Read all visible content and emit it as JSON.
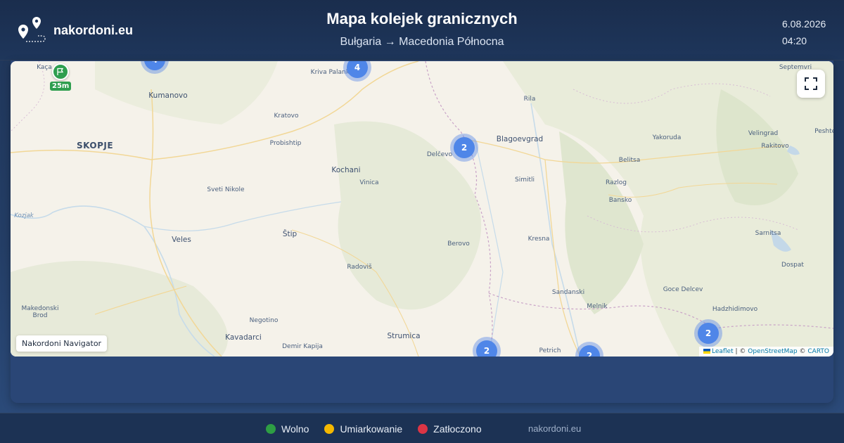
{
  "header": {
    "brand": "nakordoni.eu",
    "title": "Mapa kolejek granicznych",
    "subtitle": "Bułgaria → Macedonia Północna",
    "date": "6.08.2026",
    "time": "04:20"
  },
  "map": {
    "places": [
      {
        "name": "Kaça",
        "cls": "small"
      },
      {
        "name": "Kumanovo",
        "cls": "mid"
      },
      {
        "name": "Kriva Palanka",
        "cls": "small"
      },
      {
        "name": "Septemvri",
        "cls": "small"
      },
      {
        "name": "Rila",
        "cls": "small"
      },
      {
        "name": "Kratovo",
        "cls": "small"
      },
      {
        "name": "SKOPJE",
        "cls": "big"
      },
      {
        "name": "Probishtip",
        "cls": "small"
      },
      {
        "name": "Delčevo",
        "cls": "small"
      },
      {
        "name": "Blagoevgrad",
        "cls": "mid"
      },
      {
        "name": "Yakoruda",
        "cls": "small"
      },
      {
        "name": "Velingrad",
        "cls": "small"
      },
      {
        "name": "Peshter",
        "cls": "small"
      },
      {
        "name": "Rakitovo",
        "cls": "small"
      },
      {
        "name": "Belitsa",
        "cls": "small"
      },
      {
        "name": "Kochani",
        "cls": "mid"
      },
      {
        "name": "Vinica",
        "cls": "small"
      },
      {
        "name": "Simitli",
        "cls": "small"
      },
      {
        "name": "Razlog",
        "cls": "small"
      },
      {
        "name": "Sveti Nikole",
        "cls": "small"
      },
      {
        "name": "Bansko",
        "cls": "small"
      },
      {
        "name": "Kozjak",
        "cls": "water"
      },
      {
        "name": "Štip",
        "cls": "mid"
      },
      {
        "name": "Sarnitsa",
        "cls": "small"
      },
      {
        "name": "Veles",
        "cls": "mid"
      },
      {
        "name": "Kresna",
        "cls": "small"
      },
      {
        "name": "Berovo",
        "cls": "small"
      },
      {
        "name": "Dospat",
        "cls": "small"
      },
      {
        "name": "Radoviš",
        "cls": "small"
      },
      {
        "name": "Goce Delcev",
        "cls": "small"
      },
      {
        "name": "Sandanski",
        "cls": "small"
      },
      {
        "name": "Makedonski",
        "cls": "small"
      },
      {
        "name": "Brod",
        "cls": "small"
      },
      {
        "name": "Melnik",
        "cls": "small"
      },
      {
        "name": "Hadzhidimovo",
        "cls": "small"
      },
      {
        "name": "Negotino",
        "cls": "small"
      },
      {
        "name": "Strumica",
        "cls": "mid"
      },
      {
        "name": "Kavadarci",
        "cls": "mid"
      },
      {
        "name": "Demir Kapija",
        "cls": "small"
      },
      {
        "name": "Petrich",
        "cls": "small"
      }
    ],
    "clusters": [
      "4",
      "4",
      "2",
      "2",
      "2",
      "2"
    ],
    "crossing_badge": "25m",
    "nav_label": "Nakordoni Navigator",
    "attribution": {
      "leaflet": "Leaflet",
      "sep1": " | © ",
      "osm": "OpenStreetMap",
      "sep2": " © ",
      "carto": "CARTO"
    }
  },
  "legend": [
    {
      "label": "Wolno",
      "color": "#2e9e44"
    },
    {
      "label": "Umiarkowanie",
      "color": "#f5b800"
    },
    {
      "label": "Zatłoczono",
      "color": "#dc3545"
    }
  ],
  "footer": {
    "site": "nakordoni.eu"
  }
}
